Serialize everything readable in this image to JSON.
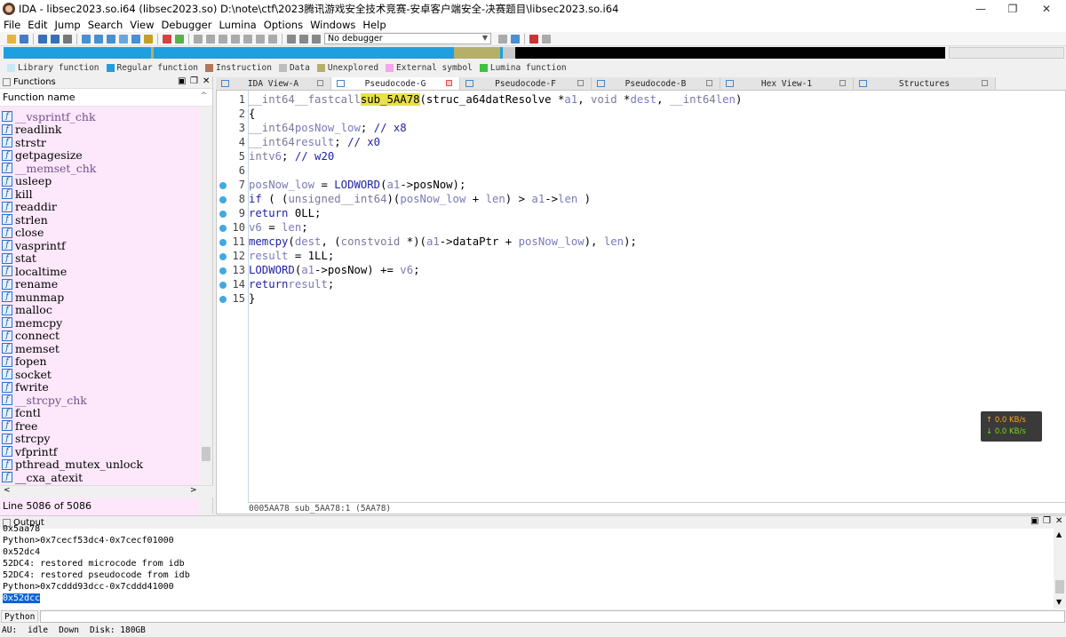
{
  "window": {
    "title": "IDA - libsec2023.so.i64 (libsec2023.so) D:\\note\\ctf\\2023腾讯游戏安全技术竞赛-安卓客户端安全-决赛题目\\libsec2023.so.i64",
    "minimize": "—",
    "maximize": "❐",
    "close": "✕"
  },
  "menu": [
    "File",
    "Edit",
    "Jump",
    "Search",
    "View",
    "Debugger",
    "Lumina",
    "Options",
    "Windows",
    "Help"
  ],
  "toolbar": {
    "debugger_select": "No debugger"
  },
  "legend": [
    {
      "label": "Library function",
      "color": "#c6e9f3"
    },
    {
      "label": "Regular function",
      "color": "#1f9ee0"
    },
    {
      "label": "Instruction",
      "color": "#b07758"
    },
    {
      "label": "Data",
      "color": "#bdbdbd"
    },
    {
      "label": "Unexplored",
      "color": "#b4b06a"
    },
    {
      "label": "External symbol",
      "color": "#f5a6ee"
    },
    {
      "label": "Lumina function",
      "color": "#3cc33c"
    }
  ],
  "functions_panel": {
    "title": "Functions",
    "column_header": "Function name",
    "status": "Line 5086 of 5086",
    "items": [
      {
        "name": "__vsprintf_chk",
        "external": true
      },
      {
        "name": "readlink",
        "external": false
      },
      {
        "name": "strstr",
        "external": false
      },
      {
        "name": "getpagesize",
        "external": false
      },
      {
        "name": "__memset_chk",
        "external": true
      },
      {
        "name": "usleep",
        "external": false
      },
      {
        "name": "kill",
        "external": false
      },
      {
        "name": "readdir",
        "external": false
      },
      {
        "name": "strlen",
        "external": false
      },
      {
        "name": "close",
        "external": false
      },
      {
        "name": "vasprintf",
        "external": false
      },
      {
        "name": "stat",
        "external": false
      },
      {
        "name": "localtime",
        "external": false
      },
      {
        "name": "rename",
        "external": false
      },
      {
        "name": "munmap",
        "external": false
      },
      {
        "name": "malloc",
        "external": false
      },
      {
        "name": "memcpy",
        "external": false
      },
      {
        "name": "connect",
        "external": false
      },
      {
        "name": "memset",
        "external": false
      },
      {
        "name": "fopen",
        "external": false
      },
      {
        "name": "socket",
        "external": false
      },
      {
        "name": "fwrite",
        "external": false
      },
      {
        "name": "__strcpy_chk",
        "external": true
      },
      {
        "name": "fcntl",
        "external": false
      },
      {
        "name": "free",
        "external": false
      },
      {
        "name": "strcpy",
        "external": false
      },
      {
        "name": "vfprintf",
        "external": false
      },
      {
        "name": "pthread_mutex_unlock",
        "external": false
      },
      {
        "name": "__cxa_atexit",
        "external": false
      }
    ]
  },
  "tabs": [
    {
      "label": "IDA View-A",
      "active": false
    },
    {
      "label": "Pseudocode-G",
      "active": true
    },
    {
      "label": "Pseudocode-F",
      "active": false
    },
    {
      "label": "Pseudocode-B",
      "active": false
    },
    {
      "label": "Hex View-1",
      "active": false
    },
    {
      "label": "Structures",
      "active": false
    }
  ],
  "code": {
    "status": "0005AA78 sub_5AA78:1 (5AA78)",
    "lines": [
      {
        "n": "1",
        "bp": false,
        "text": "__int64 __fastcall sub_5AA78(struc_a64datResolve *a1, void *dest, __int64 len)"
      },
      {
        "n": "2",
        "bp": false,
        "text": "{"
      },
      {
        "n": "3",
        "bp": false,
        "text": "  __int64 posNow_low; // x8"
      },
      {
        "n": "4",
        "bp": false,
        "text": "  __int64 result; // x0"
      },
      {
        "n": "5",
        "bp": false,
        "text": "  int v6; // w20"
      },
      {
        "n": "6",
        "bp": false,
        "text": ""
      },
      {
        "n": "7",
        "bp": true,
        "text": "  posNow_low = LODWORD(a1->posNow);"
      },
      {
        "n": "8",
        "bp": true,
        "text": "  if ( (unsigned __int64)(posNow_low + len) > a1->len )"
      },
      {
        "n": "9",
        "bp": true,
        "text": "    return 0LL;"
      },
      {
        "n": "10",
        "bp": true,
        "text": "  v6 = len;"
      },
      {
        "n": "11",
        "bp": true,
        "text": "  memcpy(dest, (const void *)(a1->dataPtr + posNow_low), len);"
      },
      {
        "n": "12",
        "bp": true,
        "text": "  result = 1LL;"
      },
      {
        "n": "13",
        "bp": true,
        "text": "  LODWORD(a1->posNow) += v6;"
      },
      {
        "n": "14",
        "bp": true,
        "text": "  return result;"
      },
      {
        "n": "15",
        "bp": true,
        "text": "}"
      }
    ]
  },
  "speed": {
    "up": "↑ 0.0 KB/s",
    "down": "↓ 0.0 KB/s"
  },
  "output": {
    "title": "Output",
    "lines": [
      "0x5aa78",
      "Python>0x7cecf53dc4-0x7cecf01000",
      "0x52dc4",
      "52DC4: restored microcode from idb",
      "52DC4: restored pseudocode from idb",
      "Python>0x7cddd93dcc-0x7cddd41000",
      "0x52dcc"
    ],
    "selected_index": 6
  },
  "python_button": "Python",
  "statusbar": {
    "au": "AU:",
    "state": "idle",
    "direction": "Down",
    "disk": "Disk: 180GB"
  }
}
